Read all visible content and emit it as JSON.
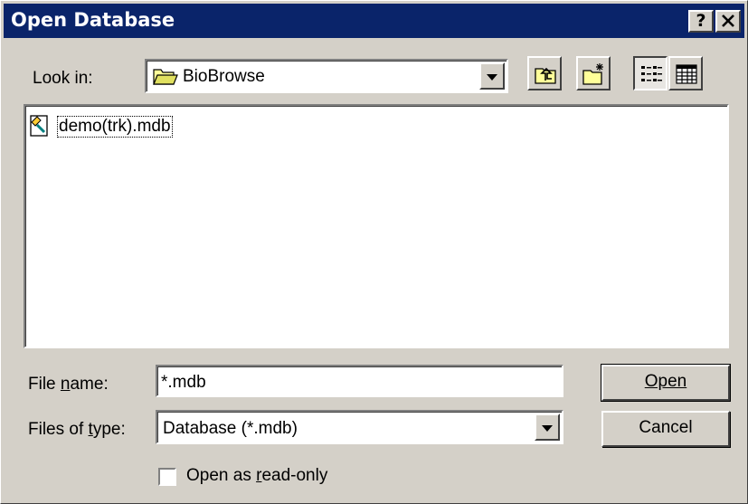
{
  "window": {
    "title": "Open Database",
    "help_button": "?",
    "close_button": "✕"
  },
  "look_in": {
    "label": "Look in:",
    "value": "BioBrowse"
  },
  "toolbar": {
    "up_folder_icon": "up-one-level-icon",
    "new_folder_icon": "create-new-folder-icon",
    "list_view_icon": "list-view-icon",
    "details_view_icon": "details-view-icon"
  },
  "files": [
    {
      "name": "demo(trk).mdb",
      "icon": "database-file-icon"
    }
  ],
  "file_name": {
    "label": "File name:",
    "value": "*.mdb"
  },
  "files_of_type": {
    "label": "Files of type:",
    "value": "Database (*.mdb)"
  },
  "buttons": {
    "open": "Open",
    "cancel": "Cancel"
  },
  "read_only": {
    "label": "Open as read-only",
    "checked": false
  },
  "colors": {
    "titlebar": "#0a246a",
    "face": "#d4d0c8",
    "window": "#ffffff"
  }
}
